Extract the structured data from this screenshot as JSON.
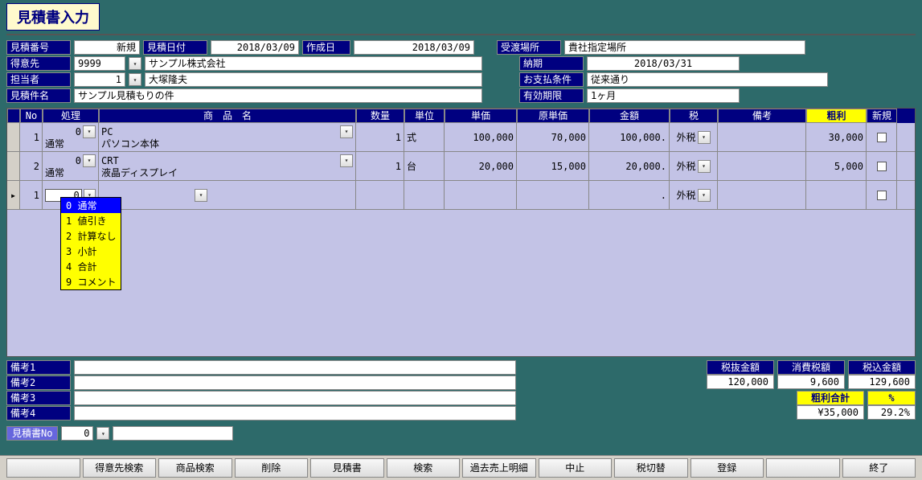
{
  "title": "見積書入力",
  "header": {
    "est_no_lbl": "見積番号",
    "est_no": "新規",
    "est_date_lbl": "見積日付",
    "est_date": "2018/03/09",
    "create_date_lbl": "作成日",
    "create_date": "2018/03/09",
    "delivery_place_lbl": "受渡場所",
    "delivery_place": "貴社指定場所",
    "customer_lbl": "得意先",
    "customer_code": "9999",
    "customer_name": "サンプル株式会社",
    "due_lbl": "納期",
    "due": "2018/03/31",
    "staff_lbl": "担当者",
    "staff_code": "1",
    "staff_name": "大塚隆夫",
    "payterm_lbl": "お支払条件",
    "payterm": "従来通り",
    "subject_lbl": "見積件名",
    "subject": "サンプル見積もりの件",
    "valid_lbl": "有効期限",
    "valid": "1ヶ月"
  },
  "cols": {
    "no": "No",
    "proc": "処理",
    "product": "商　品　名",
    "qty": "数量",
    "unit": "単位",
    "price": "単価",
    "cost": "原単価",
    "amount": "金額",
    "tax": "税",
    "remark": "備考",
    "profit": "粗利",
    "new": "新規"
  },
  "rows": [
    {
      "no": "1",
      "proc_code": "0",
      "proc": "通常",
      "code": "PC",
      "name": "パソコン本体",
      "qty": "1",
      "unit": "式",
      "price": "100,000",
      "cost": "70,000",
      "amount": "100,000.",
      "tax": "外税",
      "profit": "30,000"
    },
    {
      "no": "2",
      "proc_code": "0",
      "proc": "通常",
      "code": "CRT",
      "name": "液晶ディスプレイ",
      "qty": "1",
      "unit": "台",
      "price": "20,000",
      "cost": "15,000",
      "amount": "20,000.",
      "tax": "外税",
      "profit": "5,000"
    },
    {
      "no": "1",
      "proc_code": "0",
      "proc": "",
      "code": "",
      "name": "",
      "qty": "",
      "unit": "",
      "price": "",
      "cost": "",
      "amount": ".",
      "tax": "外税",
      "profit": ""
    }
  ],
  "proc_options": [
    {
      "n": "0",
      "l": "通常"
    },
    {
      "n": "1",
      "l": "値引き"
    },
    {
      "n": "2",
      "l": "計算なし"
    },
    {
      "n": "3",
      "l": "小計"
    },
    {
      "n": "4",
      "l": "合計"
    },
    {
      "n": "9",
      "l": "コメント"
    }
  ],
  "remarks": {
    "r1_lbl": "備考1",
    "r2_lbl": "備考2",
    "r3_lbl": "備考3",
    "r4_lbl": "備考4"
  },
  "totals": {
    "net_lbl": "税抜金額",
    "net": "120,000",
    "tax_lbl": "消費税額",
    "tax": "9,600",
    "gross_lbl": "税込金額",
    "gross": "129,600",
    "profit_lbl": "粗利合計",
    "pct_lbl": "%",
    "profit": "¥35,000",
    "pct": "29.2%"
  },
  "docno_lbl": "見積書No",
  "docno": "0",
  "buttons": {
    "b1": "",
    "b2": "得意先検索",
    "b3": "商品検索",
    "b4": "削除",
    "b5": "見積書",
    "b6": "検索",
    "b7": "過去売上明細",
    "b8": "中止",
    "b9": "税切替",
    "b10": "登録",
    "b11": "",
    "b12": "終了"
  }
}
